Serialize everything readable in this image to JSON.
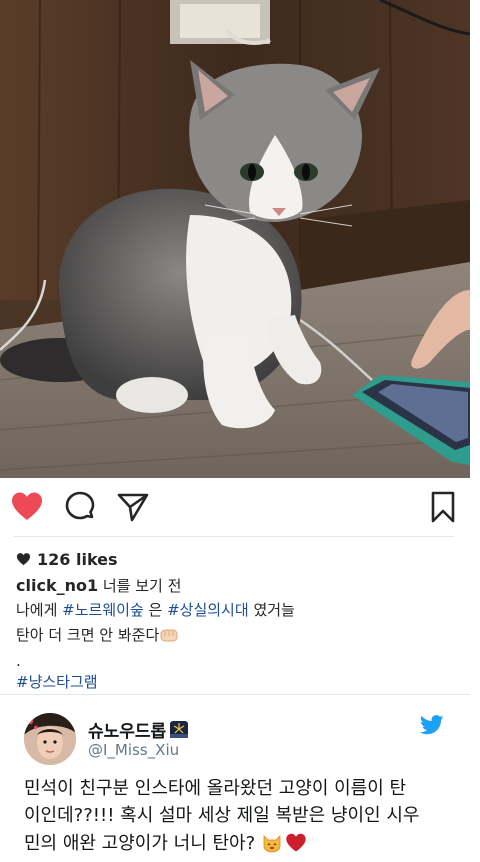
{
  "post": {
    "photo_description_icon": "cat-photo",
    "likes_icon": "heart-icon",
    "likes": "126 likes",
    "username": "click_no1",
    "caption_line1_rest": " 너를 보기 전",
    "caption_line2_pre": "나에게 ",
    "caption_tag1": "#노르웨이숲",
    "caption_line2_mid": " 은 ",
    "caption_tag2": "#상실의시대",
    "caption_line2_post": " 였거늘",
    "caption_line3": "탄아 더 크면 안 봐준다",
    "caption_dot": ".",
    "caption_tag3": "#냥스타그램",
    "colors": {
      "like": "#ed4956",
      "hashtag": "#1d4f91"
    }
  },
  "tweet": {
    "display_name": "슈노우드롭",
    "handle": "@I_Miss_Xiu",
    "text_line1": "민석이 친구분 인스타에 올라왔던 고양이 이름이 탄",
    "text_line2": "이인데??!!! 혹시 설마 세상 제일 복받은 냥이인 시우",
    "text_line3": "민의 애완 고양이가 너니 탄아?",
    "colors": {
      "twitter_blue": "#1da1f2",
      "heart": "#cc1f2e"
    }
  }
}
